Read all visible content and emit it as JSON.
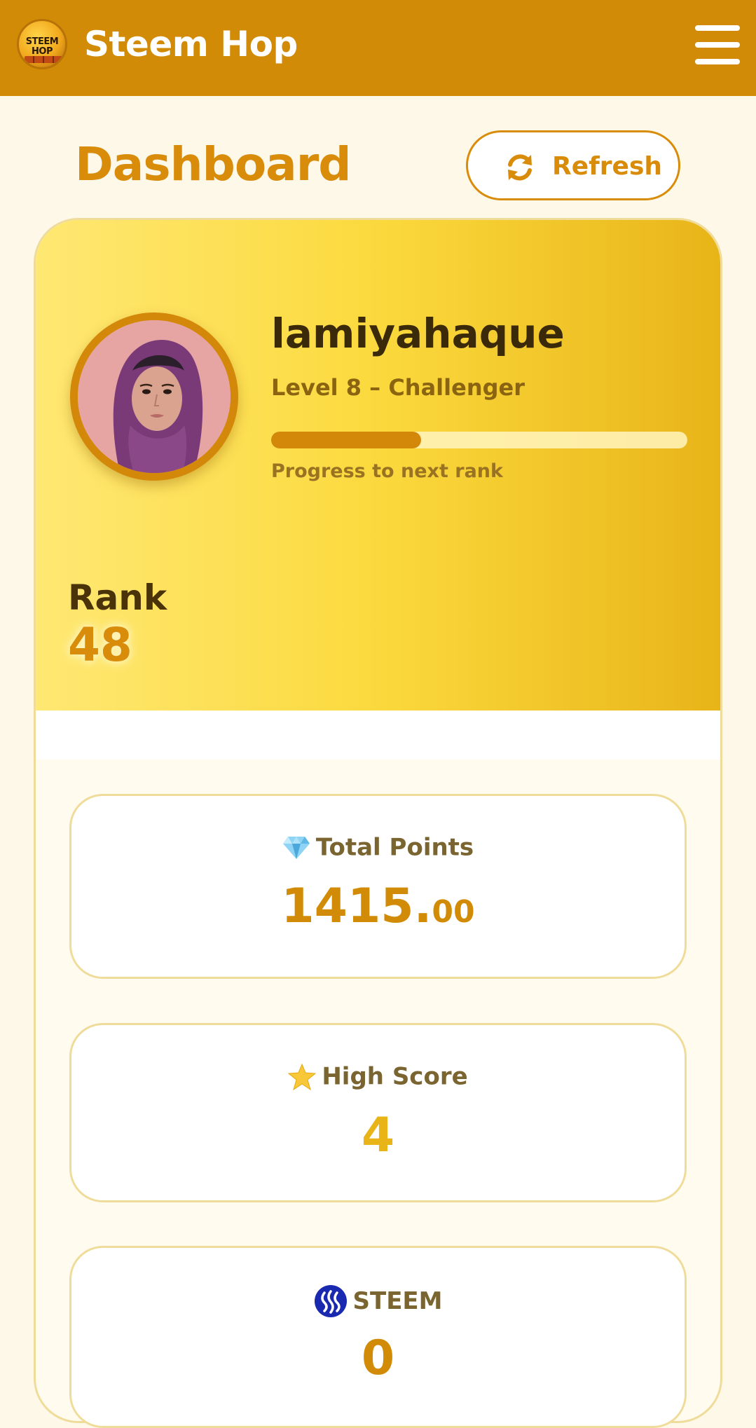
{
  "header": {
    "app_title": "Steem Hop",
    "logo_text_1": "STEEM",
    "logo_text_2": "HOP",
    "menu_icon": "hamburger-menu-icon",
    "bg_color": "#d18b06"
  },
  "page": {
    "title": "Dashboard",
    "refresh_label": "Refresh",
    "refresh_icon": "sync-icon",
    "accent_color": "#d88c0a"
  },
  "profile": {
    "username": "lamiyahaque",
    "level": "Level 8 – Challenger",
    "progress_fraction": 0.36,
    "progress_label": "Progress to next rank",
    "rank_label": "Rank",
    "rank_value": "48"
  },
  "stats": [
    {
      "icon": "gem-icon",
      "label": "Total Points",
      "value_main": "1415.",
      "value_decimal": "00"
    },
    {
      "icon": "star-icon",
      "label": "High Score",
      "value": "4",
      "color": "#e8b418"
    },
    {
      "icon": "steem-icon",
      "label": "STEEM",
      "value": "0",
      "color": "#d18b06"
    }
  ]
}
